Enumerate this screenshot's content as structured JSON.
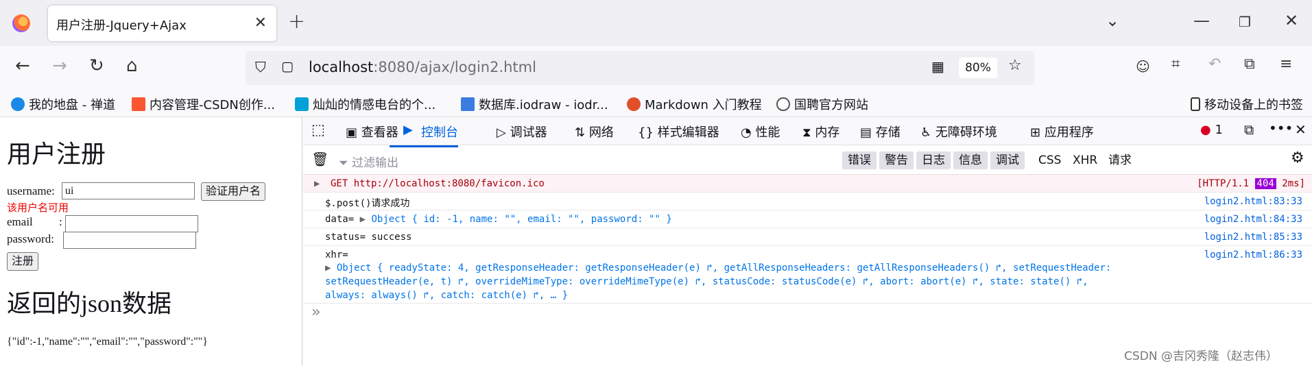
{
  "browser": {
    "tab_title": "用户注册-Jquery+Ajax",
    "url_host": "localhost",
    "url_rest": ":8080/ajax/login2.html",
    "zoom": "80%"
  },
  "bookmarks": [
    {
      "label": "我的地盘 - 禅道",
      "color": "#1a88e6"
    },
    {
      "label": "内容管理-CSDN创作...",
      "color": "#fc5531"
    },
    {
      "label": "灿灿的情感电台的个...",
      "color": "#00a1d6"
    },
    {
      "label": "数据库.iodraw - iodr...",
      "color": "#3c7be0"
    },
    {
      "label": "Markdown 入门教程",
      "color": "#e04f2a"
    },
    {
      "label": "国聘官方网站",
      "color": "#555555"
    },
    {
      "label": "移动设备上的书签",
      "color": "#333333"
    }
  ],
  "page": {
    "title": "用户注册",
    "username_label": "username:",
    "username_value": "ui",
    "verify_button": "验证用户名",
    "available_msg": "该用户名可用",
    "email_label": "email",
    "email_colon": ":",
    "password_label": "password:",
    "register_button": "注册",
    "json_title": "返回的json数据",
    "json_text": "{\"id\":-1,\"name\":\"\",\"email\":\"\",\"password\":\"\"}"
  },
  "devtools": {
    "tabs": [
      "查看器",
      "控制台",
      "调试器",
      "网络",
      "样式编辑器",
      "性能",
      "内存",
      "存储",
      "无障碍环境",
      "应用程序"
    ],
    "active_tab": "控制台",
    "error_count": "1",
    "filter_placeholder": "过滤输出",
    "filter_chips": [
      "错误",
      "警告",
      "日志",
      "信息",
      "调试"
    ],
    "filter_right": [
      "CSS",
      "XHR",
      "请求"
    ],
    "console": {
      "row1": {
        "msg": "GET http://localhost:8080/favicon.ico",
        "status_pre": "[HTTP/1.1",
        "status_code": "404",
        "status_post": "2ms]"
      },
      "row2": {
        "msg": "$.post()请求成功",
        "loc": "login2.html:83:33"
      },
      "row3": {
        "prefix": "data=",
        "obj": "Object { id: -1, name: \"\", email: \"\", password: \"\" }",
        "loc": "login2.html:84:33"
      },
      "row4": {
        "msg": "status= success",
        "loc": "login2.html:85:33"
      },
      "row5": {
        "prefix": "xhr=",
        "line1": "Object { readyState: 4, getResponseHeader: getResponseHeader(e) ↱, getAllResponseHeaders: getAllResponseHeaders() ↱, setRequestHeader:",
        "line2": "setRequestHeader(e, t) ↱, overrideMimeType: overrideMimeType(e) ↱, statusCode: statusCode(e) ↱, abort: abort(e) ↱, state: state() ↱,",
        "line3": "always: always() ↱, catch: catch(e) ↱, … }",
        "loc": "login2.html:86:33"
      }
    },
    "prompt": "»"
  },
  "watermark": "CSDN @吉冈秀隆（赵志伟）",
  "colors": {
    "accent": "#0060df",
    "error_bg": "#fdf2f5",
    "error_text": "#a4000f",
    "badge": "#9a00d7"
  }
}
